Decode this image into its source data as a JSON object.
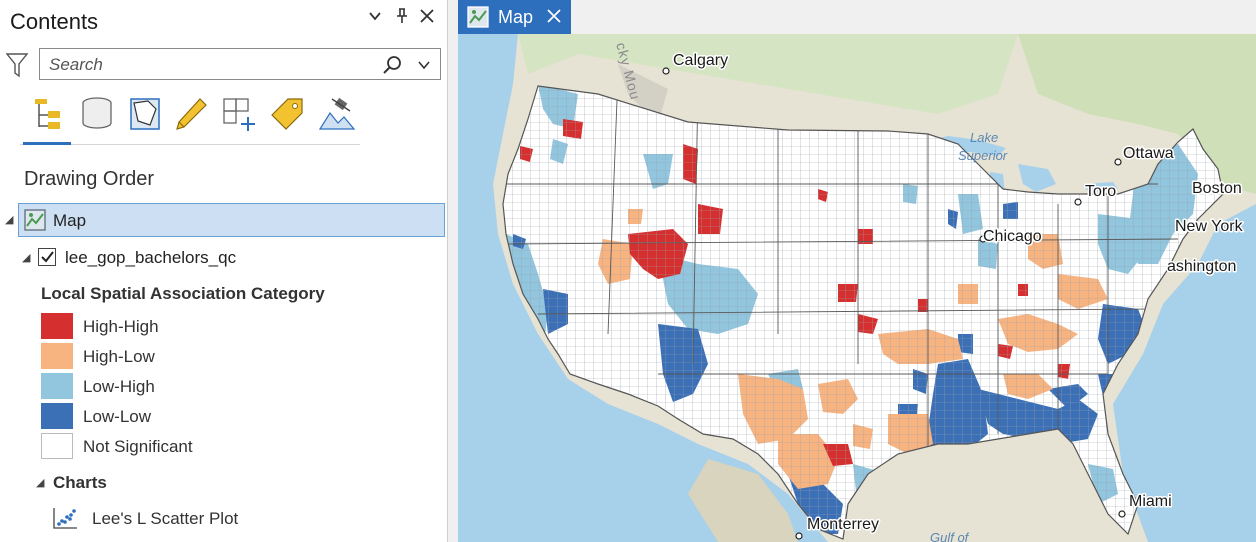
{
  "contents": {
    "title": "Contents",
    "search_placeholder": "Search",
    "drawing_order_label": "Drawing Order",
    "map_item": "Map",
    "layer_name": "lee_gop_bachelors_qc",
    "layer_checked": true,
    "legend_title": "Local Spatial Association Category",
    "legend": [
      {
        "label": "High-High",
        "color": "#d62f2f"
      },
      {
        "label": "High-Low",
        "color": "#f7b380"
      },
      {
        "label": "Low-High",
        "color": "#92c5de"
      },
      {
        "label": "Low-Low",
        "color": "#3b6fb6"
      },
      {
        "label": "Not Significant",
        "color": "#ffffff"
      }
    ],
    "charts_group": "Charts",
    "chart_item": "Lee's L Scatter Plot",
    "toolbar_icons": [
      "list-by-drawing-order-icon",
      "list-by-source-icon",
      "list-by-selection-icon",
      "list-by-editing-icon",
      "list-by-snapping-icon",
      "list-by-labeling-icon",
      "list-by-perspective-imagery-icon"
    ]
  },
  "map_view": {
    "tab_label": "Map",
    "accent": "#2d6ebd",
    "labels": {
      "calgary": "Calgary",
      "ottawa": "Ottawa",
      "toronto": "Toro",
      "boston": "Boston",
      "newyork": "New York",
      "washington": "ashington",
      "chicago": "Chicago",
      "miami": "Miami",
      "monterrey": "Monterrey",
      "lake_superior_1": "Lake",
      "lake_superior_2": "Superior",
      "gulf": "Gulf of",
      "rocky": "cky Mou"
    }
  }
}
